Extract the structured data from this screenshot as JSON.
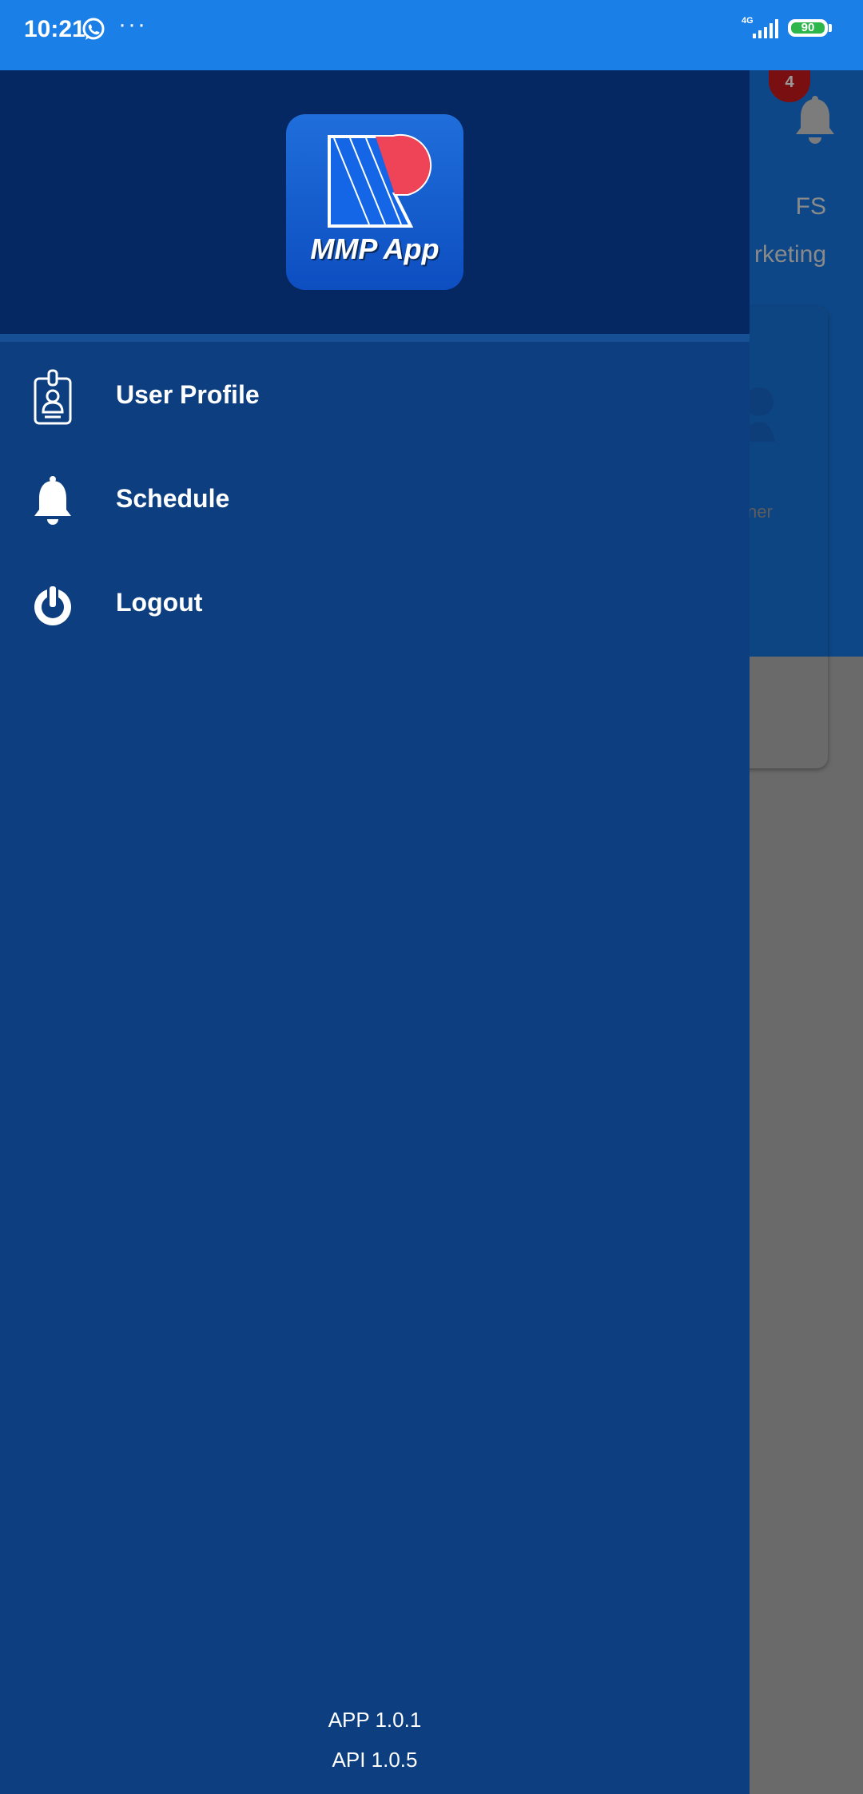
{
  "status_bar": {
    "time": "10:21",
    "dots": "···",
    "network": "4G",
    "battery": "90"
  },
  "background": {
    "badge_count": "4",
    "fs_label": "FS",
    "marketing_label": "rketing",
    "owner_label": "ner"
  },
  "drawer": {
    "logo_text": "MMP App",
    "menu": [
      {
        "label": "User Profile",
        "icon": "id-badge-icon"
      },
      {
        "label": "Schedule",
        "icon": "bell-icon"
      },
      {
        "label": "Logout",
        "icon": "power-icon"
      }
    ],
    "app_version": "APP 1.0.1",
    "api_version": "API 1.0.5"
  },
  "colors": {
    "status_bar": "#1b7fe8",
    "drawer_bg": "#0c3e80",
    "drawer_header": "#062862",
    "logo_red": "#ef4358",
    "battery_green": "#2db64a"
  }
}
